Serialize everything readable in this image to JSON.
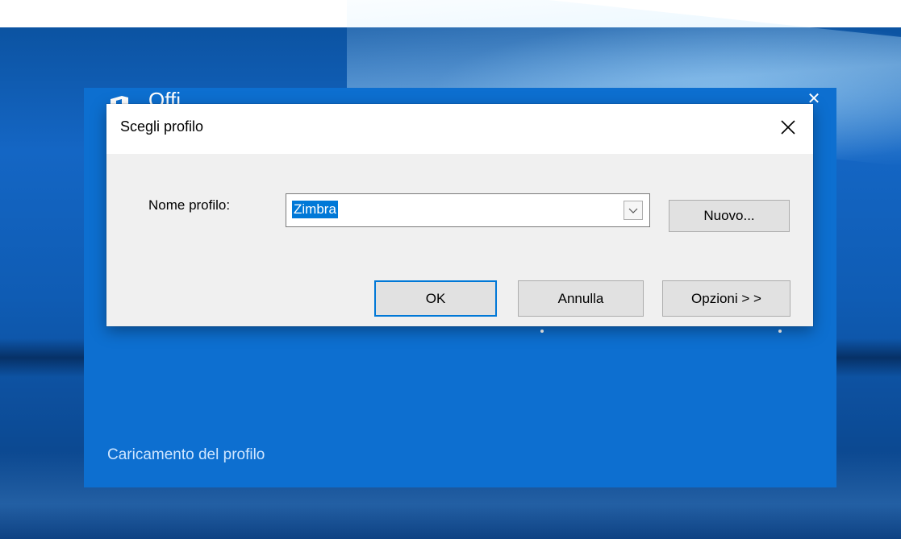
{
  "splash": {
    "brand_text": "Offi",
    "close_glyph": "✕",
    "status_text": "Caricamento del profilo",
    "background": "#0d6fd0",
    "logo_color": "#ffffff"
  },
  "dialog": {
    "title": "Scegli profilo",
    "profile_label": "Nome profilo:",
    "profile_value": "Zimbra",
    "new_button": "Nuovo...",
    "ok_button": "OK",
    "cancel_button": "Annulla",
    "options_button": "Opzioni > >",
    "accent_color": "#0078d7"
  },
  "icons": {
    "office_logo": "office-logo-icon",
    "splash_close": "close-icon",
    "dialog_close": "close-icon",
    "dropdown": "chevron-down-icon"
  }
}
